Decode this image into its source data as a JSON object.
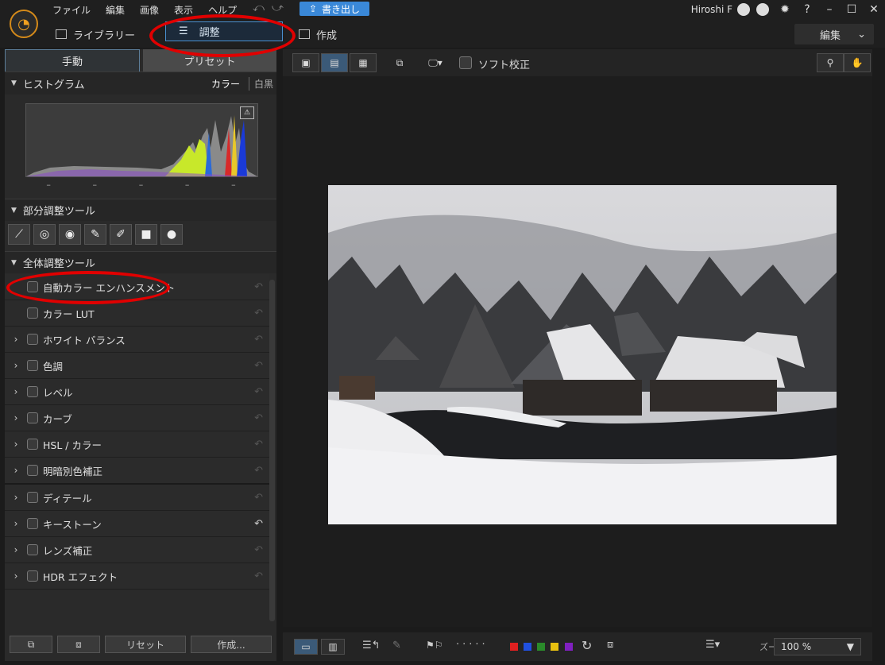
{
  "menu": [
    "ファイル",
    "編集",
    "画像",
    "表示",
    "ヘルプ"
  ],
  "export_label": "書き出し",
  "user": {
    "name": "Hiroshi F"
  },
  "modes": {
    "library": "ライブラリー",
    "adjust": "調整",
    "create": "作成"
  },
  "edit_select": "編集",
  "panel": {
    "tab_manual": "手動",
    "tab_preset": "プリセット",
    "histogram_title": "ヒストグラム",
    "color_label": "カラー",
    "mono_label": "白黒",
    "hist_dashes": [
      "–",
      "–",
      "–",
      "–",
      "–"
    ],
    "local_tools_title": "部分調整ツール",
    "global_tools_title": "全体調整ツール",
    "items": [
      {
        "label": "自動カラー エンハンスメント",
        "expandable": false
      },
      {
        "label": "カラー LUT",
        "expandable": false
      },
      {
        "label": "ホワイト バランス",
        "expandable": true
      },
      {
        "label": "色調",
        "expandable": true
      },
      {
        "label": "レベル",
        "expandable": true
      },
      {
        "label": "カーブ",
        "expandable": true
      },
      {
        "label": "HSL / カラー",
        "expandable": true
      },
      {
        "label": "明暗別色補正",
        "expandable": true
      },
      {
        "label": "ディテール",
        "expandable": true
      },
      {
        "label": "キーストーン",
        "expandable": true
      },
      {
        "label": "レンズ補正",
        "expandable": true
      },
      {
        "label": "HDR エフェクト",
        "expandable": true
      }
    ],
    "reset_label": "リセット",
    "create_label": "作成..."
  },
  "viewer": {
    "soft_proof": "ソフト校正",
    "zoom_label": "ズーム:",
    "zoom_value": "100 %"
  },
  "colors": {
    "accent": "#3a88d8",
    "annotation": "#e10000"
  }
}
